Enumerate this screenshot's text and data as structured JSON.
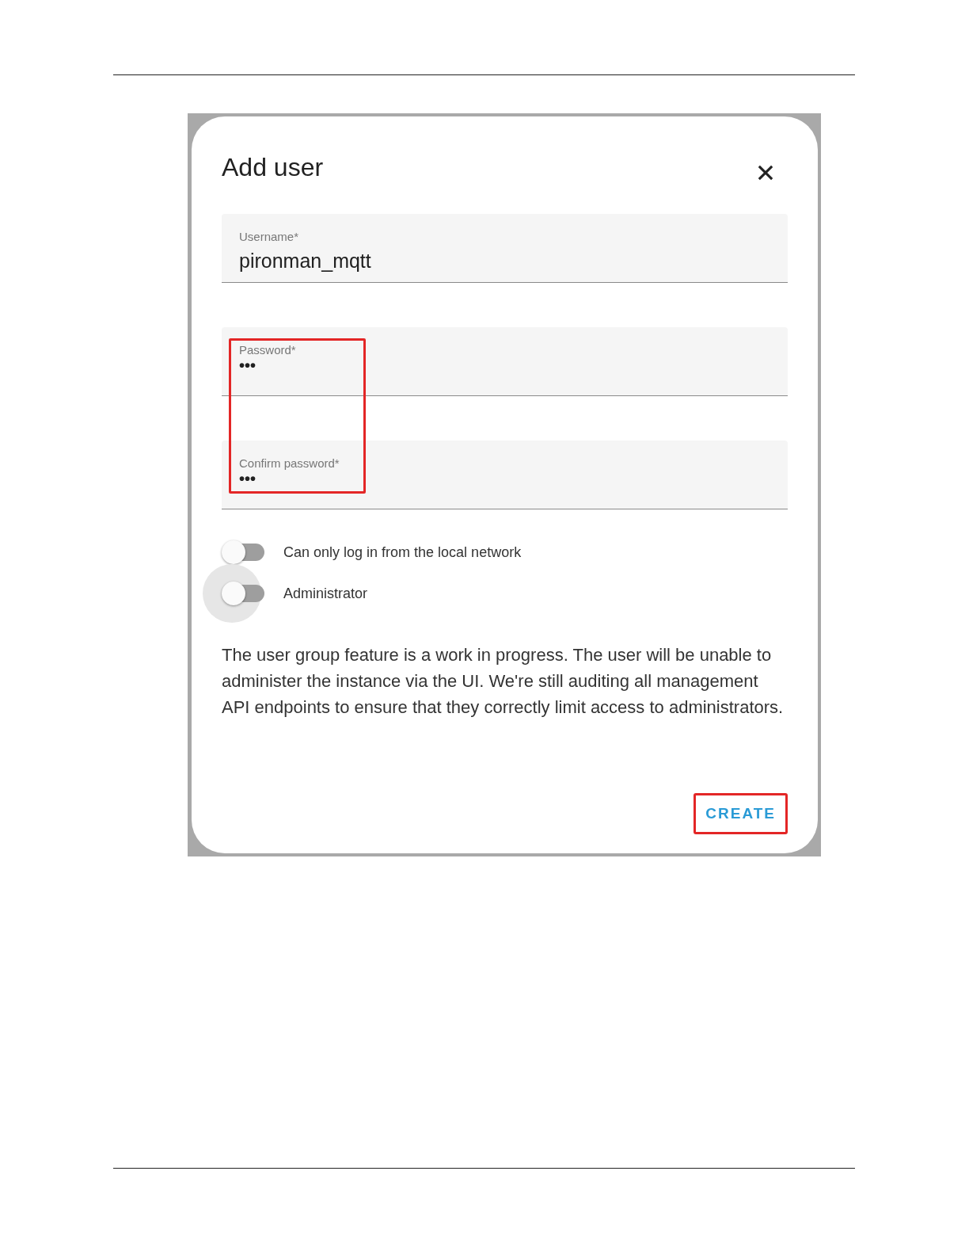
{
  "dialog": {
    "title": "Add user",
    "fields": [
      {
        "label": "Username*",
        "value": "pironman_mqtt",
        "kind": "text"
      },
      {
        "label": "Password*",
        "value": "•••",
        "kind": "password"
      },
      {
        "label": "Confirm password*",
        "value": "•••",
        "kind": "password"
      }
    ],
    "password_highlight": true,
    "toggles": [
      {
        "label": "Can only log in from the local network",
        "on": false,
        "focused": false
      },
      {
        "label": "Administrator",
        "on": false,
        "focused": true
      }
    ],
    "note": "The user group feature is a work in progress. The user will be unable to administer the instance via the UI. We're still auditing all management API endpoints to ensure that they correctly limit access to administrators.",
    "button": {
      "label": "CREATE",
      "highlighted": true
    }
  }
}
